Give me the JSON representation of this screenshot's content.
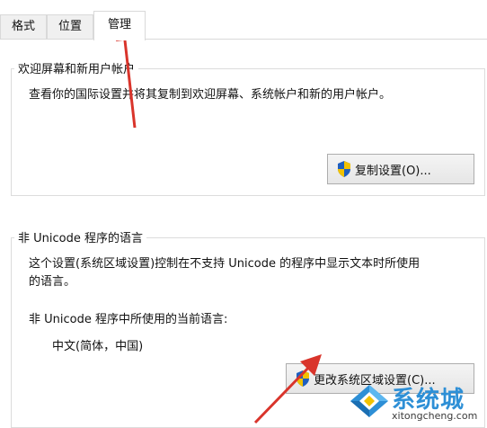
{
  "tabs": [
    {
      "label": "格式"
    },
    {
      "label": "位置"
    },
    {
      "label": "管理"
    }
  ],
  "welcome_group": {
    "title": "欢迎屏幕和新用户帐户",
    "description": "查看你的国际设置并将其复制到欢迎屏幕、系统帐户和新的用户帐户。",
    "copy_button_label": "复制设置(O)..."
  },
  "unicode_group": {
    "title": "非 Unicode 程序的语言",
    "description_line1": "这个设置(系统区域设置)控制在不支持 Unicode 的程序中显示文本时所使用",
    "description_line2": "的语言。",
    "current_label": "非 Unicode 程序中所使用的当前语言:",
    "current_value": "中文(简体，中国)",
    "change_button_label": "更改系统区域设置(C)..."
  },
  "watermark": {
    "brand": "系统城",
    "url": "xitongcheng.com"
  },
  "icons": [
    "shield-icon",
    "red-arrow",
    "xitongcheng-logo"
  ],
  "colors": {
    "arrow": "#d9342b",
    "brand": "#2d8fd6",
    "shield_blue": "#1f5fbf",
    "shield_yellow": "#f2c200"
  }
}
